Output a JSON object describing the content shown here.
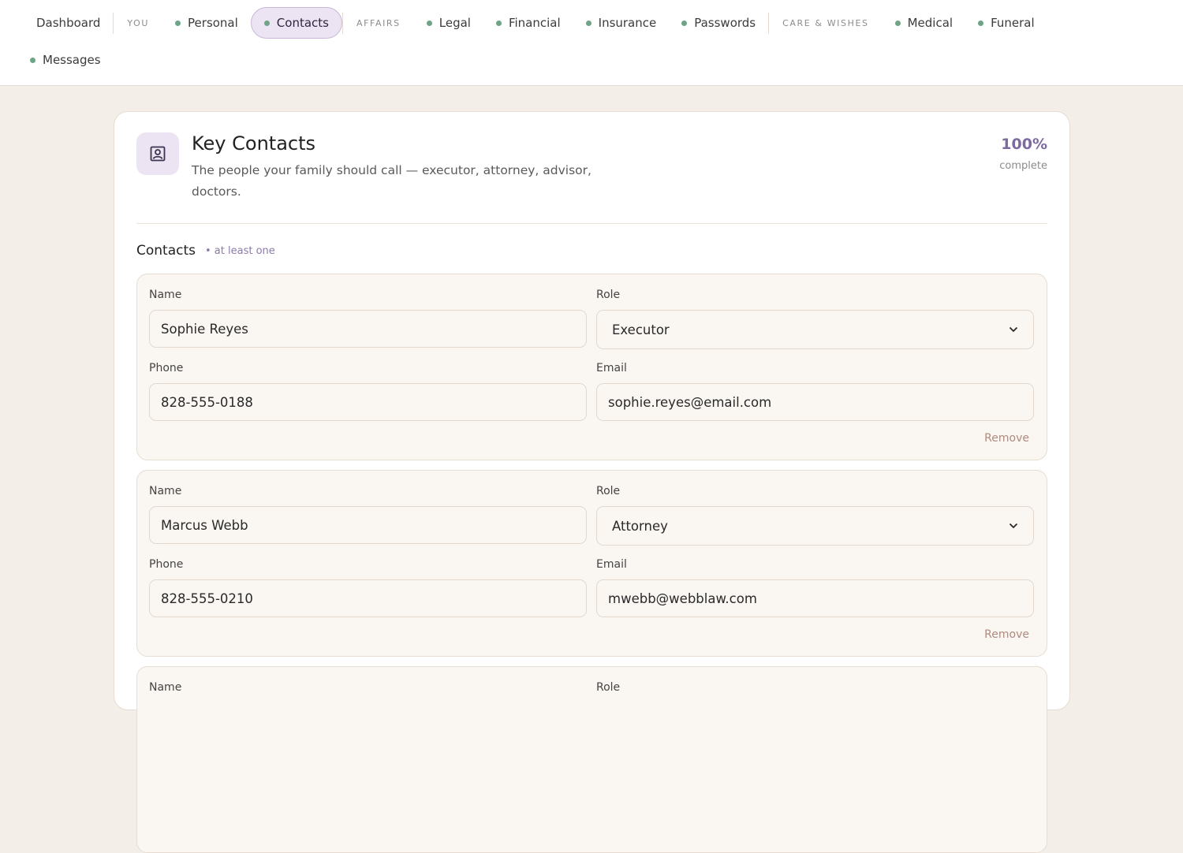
{
  "nav": {
    "dashboard": "Dashboard",
    "group_you": "YOU",
    "personal": "Personal",
    "contacts": "Contacts",
    "group_affairs": "AFFAIRS",
    "legal": "Legal",
    "financial": "Financial",
    "insurance": "Insurance",
    "passwords": "Passwords",
    "group_care": "CARE & WISHES",
    "medical": "Medical",
    "funeral": "Funeral",
    "messages": "Messages",
    "active": "Contacts",
    "dot_color": "#6ea486",
    "active_bg": "#ece4f2"
  },
  "header": {
    "icon": "contact-card-icon",
    "title": "Key Contacts",
    "subtitle": "The people your family should call — executor, attorney, advisor, doctors.",
    "progress_value": "100%",
    "progress_label": "complete",
    "accent_color": "#7c6aa0"
  },
  "section": {
    "title": "Contacts",
    "hint": "• at least one"
  },
  "labels": {
    "name": "Name",
    "role": "Role",
    "phone": "Phone",
    "email": "Email",
    "remove": "Remove"
  },
  "contacts": [
    {
      "name": "Sophie Reyes",
      "role": "Executor",
      "phone": "828-555-0188",
      "email": "sophie.reyes@email.com"
    },
    {
      "name": "Marcus Webb",
      "role": "Attorney",
      "phone": "828-555-0210",
      "email": "mwebb@webblaw.com"
    }
  ]
}
